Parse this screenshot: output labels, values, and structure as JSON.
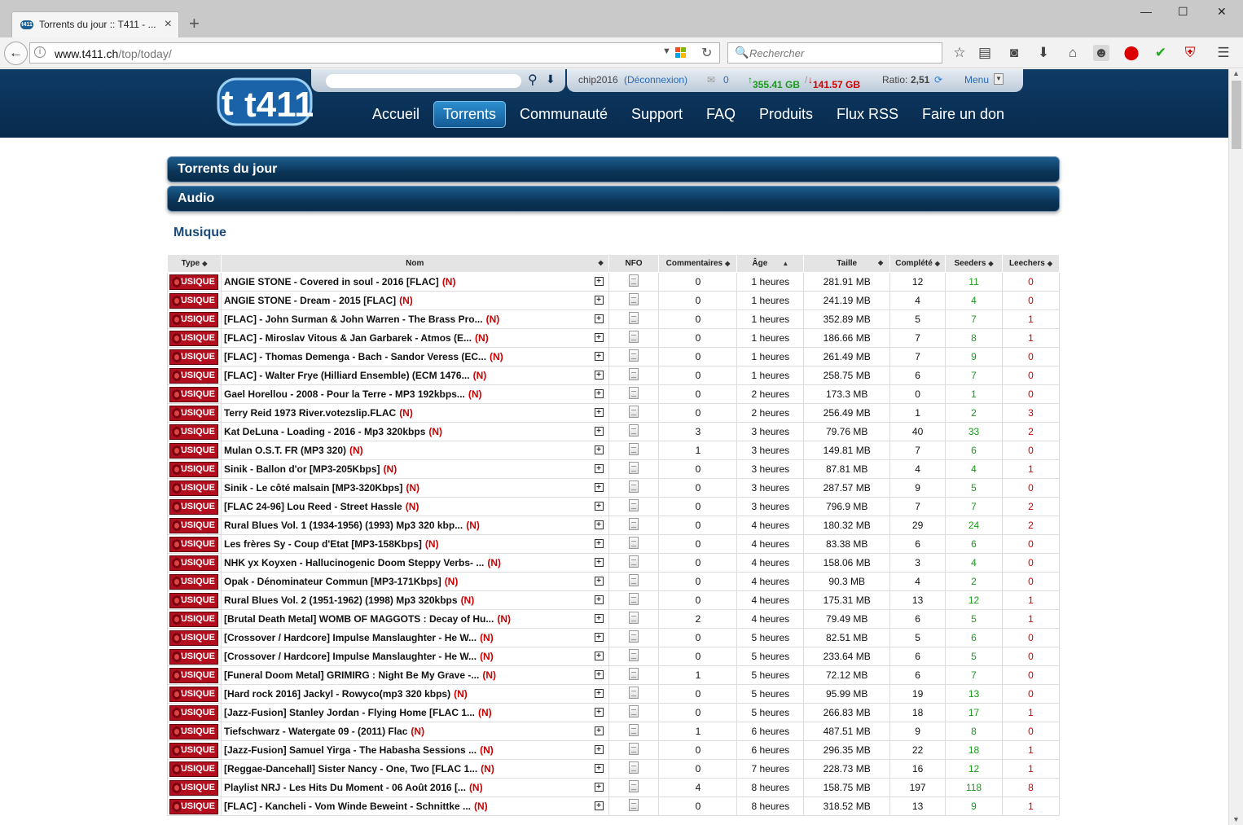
{
  "browser": {
    "tab_title": "Torrents du jour :: T411 - ...",
    "tab_close": "×",
    "new_tab": "+",
    "url_domain": "www.t411.ch",
    "url_path": "/top/today/",
    "search_placeholder": "Rechercher",
    "window_controls": [
      "—",
      "☐",
      "✕"
    ]
  },
  "site": {
    "logo_text": "t411",
    "user": {
      "username": "chip2016",
      "logout": "(Déconnexion)",
      "messages": "0",
      "upload": "355.41 GB",
      "download": "141.57 GB",
      "ratio_label": "Ratio:",
      "ratio": "2,51",
      "menu": "Menu"
    },
    "nav": [
      "Accueil",
      "Torrents",
      "Communauté",
      "Support",
      "FAQ",
      "Produits",
      "Flux RSS",
      "Faire un don"
    ],
    "active_nav": "Torrents"
  },
  "content": {
    "bar_title": "Torrents du jour",
    "category_bar": "Audio",
    "section_title": "Musique",
    "columns": [
      "Type",
      "Nom",
      "NFO",
      "Commentaires",
      "Âge",
      "Taille",
      "Complété",
      "Seeders",
      "Leechers"
    ],
    "badge_label": "MUSIQUE",
    "new_marker": "(N)",
    "rows": [
      {
        "name": "ANGIE STONE - Covered in soul - 2016 [FLAC]",
        "comments": "0",
        "age": "1 heures",
        "size": "281.91 MB",
        "completed": "12",
        "seeders": "11",
        "leechers": "0"
      },
      {
        "name": "ANGIE STONE - Dream - 2015 [FLAC]",
        "comments": "0",
        "age": "1 heures",
        "size": "241.19 MB",
        "completed": "4",
        "seeders": "4",
        "leechers": "0"
      },
      {
        "name": "[FLAC] - John Surman & John Warren - The Brass Pro...",
        "comments": "0",
        "age": "1 heures",
        "size": "352.89 MB",
        "completed": "5",
        "seeders": "7",
        "leechers": "1"
      },
      {
        "name": "[FLAC] - Miroslav Vitous & Jan Garbarek - Atmos (E...",
        "comments": "0",
        "age": "1 heures",
        "size": "186.66 MB",
        "completed": "7",
        "seeders": "8",
        "leechers": "1"
      },
      {
        "name": "[FLAC] - Thomas Demenga - Bach - Sandor Veress (EC...",
        "comments": "0",
        "age": "1 heures",
        "size": "261.49 MB",
        "completed": "7",
        "seeders": "9",
        "leechers": "0"
      },
      {
        "name": "[FLAC] - Walter Frye (Hilliard Ensemble) (ECM 1476...",
        "comments": "0",
        "age": "1 heures",
        "size": "258.75 MB",
        "completed": "6",
        "seeders": "7",
        "leechers": "0"
      },
      {
        "name": "Gael Horellou - 2008 - Pour la Terre - MP3 192kbps...",
        "comments": "0",
        "age": "2 heures",
        "size": "173.3 MB",
        "completed": "0",
        "seeders": "1",
        "leechers": "0"
      },
      {
        "name": "Terry Reid 1973 River.votezslip.FLAC",
        "comments": "0",
        "age": "2 heures",
        "size": "256.49 MB",
        "completed": "1",
        "seeders": "2",
        "leechers": "3"
      },
      {
        "name": "Kat DeLuna - Loading - 2016 - Mp3 320kbps",
        "comments": "3",
        "age": "3 heures",
        "size": "79.76 MB",
        "completed": "40",
        "seeders": "33",
        "leechers": "2"
      },
      {
        "name": "Mulan O.S.T. FR (MP3 320)",
        "comments": "1",
        "age": "3 heures",
        "size": "149.81 MB",
        "completed": "7",
        "seeders": "6",
        "leechers": "0"
      },
      {
        "name": "Sinik - Ballon d'or [MP3-205Kbps]",
        "comments": "0",
        "age": "3 heures",
        "size": "87.81 MB",
        "completed": "4",
        "seeders": "4",
        "leechers": "1"
      },
      {
        "name": "Sinik - Le côté malsain [MP3-320Kbps]",
        "comments": "0",
        "age": "3 heures",
        "size": "287.57 MB",
        "completed": "9",
        "seeders": "5",
        "leechers": "0"
      },
      {
        "name": "[FLAC 24-96] Lou Reed - Street Hassle",
        "comments": "0",
        "age": "3 heures",
        "size": "796.9 MB",
        "completed": "7",
        "seeders": "7",
        "leechers": "2"
      },
      {
        "name": "Rural Blues Vol. 1 (1934-1956) (1993) Mp3 320 kbp...",
        "comments": "0",
        "age": "4 heures",
        "size": "180.32 MB",
        "completed": "29",
        "seeders": "24",
        "leechers": "2"
      },
      {
        "name": "Les frères Sy - Coup d'Etat [MP3-158Kbps]",
        "comments": "0",
        "age": "4 heures",
        "size": "83.38 MB",
        "completed": "6",
        "seeders": "6",
        "leechers": "0"
      },
      {
        "name": "NHK yx Koyxen - Hallucinogenic Doom Steppy Verbs- ...",
        "comments": "0",
        "age": "4 heures",
        "size": "158.06 MB",
        "completed": "3",
        "seeders": "4",
        "leechers": "0"
      },
      {
        "name": "Opak - Dénominateur Commun [MP3-171Kbps]",
        "comments": "0",
        "age": "4 heures",
        "size": "90.3 MB",
        "completed": "4",
        "seeders": "2",
        "leechers": "0"
      },
      {
        "name": "Rural Blues Vol. 2 (1951-1962) (1998) Mp3 320kbps",
        "comments": "0",
        "age": "4 heures",
        "size": "175.31 MB",
        "completed": "13",
        "seeders": "12",
        "leechers": "1"
      },
      {
        "name": "[Brutal Death Metal] WOMB OF MAGGOTS : Decay of Hu...",
        "comments": "2",
        "age": "4 heures",
        "size": "79.49 MB",
        "completed": "6",
        "seeders": "5",
        "leechers": "1"
      },
      {
        "name": "[Crossover / Hardcore] Impulse Manslaughter - He W...",
        "comments": "0",
        "age": "5 heures",
        "size": "82.51 MB",
        "completed": "5",
        "seeders": "6",
        "leechers": "0"
      },
      {
        "name": "[Crossover / Hardcore] Impulse Manslaughter - He W...",
        "comments": "0",
        "age": "5 heures",
        "size": "233.64 MB",
        "completed": "6",
        "seeders": "5",
        "leechers": "0"
      },
      {
        "name": "[Funeral Doom Metal] GRIMIRG : Night Be My Grave -...",
        "comments": "1",
        "age": "5 heures",
        "size": "72.12 MB",
        "completed": "6",
        "seeders": "7",
        "leechers": "0"
      },
      {
        "name": "[Hard rock 2016] Jackyl - Rowyco(mp3 320 kbps)",
        "comments": "0",
        "age": "5 heures",
        "size": "95.99 MB",
        "completed": "19",
        "seeders": "13",
        "leechers": "0"
      },
      {
        "name": "[Jazz-Fusion] Stanley Jordan - Flying Home [FLAC 1...",
        "comments": "0",
        "age": "5 heures",
        "size": "266.83 MB",
        "completed": "18",
        "seeders": "17",
        "leechers": "1"
      },
      {
        "name": "Tiefschwarz - Watergate 09 - (2011) Flac",
        "comments": "1",
        "age": "6 heures",
        "size": "487.51 MB",
        "completed": "9",
        "seeders": "8",
        "leechers": "0"
      },
      {
        "name": "[Jazz-Fusion] Samuel Yirga - The Habasha Sessions ...",
        "comments": "0",
        "age": "6 heures",
        "size": "296.35 MB",
        "completed": "22",
        "seeders": "18",
        "leechers": "1"
      },
      {
        "name": "[Reggae-Dancehall] Sister Nancy - One, Two [FLAC 1...",
        "comments": "0",
        "age": "7 heures",
        "size": "228.73 MB",
        "completed": "16",
        "seeders": "12",
        "leechers": "1"
      },
      {
        "name": "Playlist NRJ - Les Hits Du Moment - 06 Août 2016 [...",
        "comments": "4",
        "age": "8 heures",
        "size": "158.75 MB",
        "completed": "197",
        "seeders": "118",
        "leechers": "8"
      },
      {
        "name": "[FLAC] - Kancheli - Vom Winde Beweint - Schnittke ...",
        "comments": "0",
        "age": "8 heures",
        "size": "318.52 MB",
        "completed": "13",
        "seeders": "9",
        "leechers": "1"
      }
    ]
  },
  "colors": {
    "header_bg": "#0b3558",
    "badge_red": "#b30e1e",
    "seeders_green": "#1a9a1a",
    "leechers_red": "#d10000",
    "new_red": "#cc0000"
  }
}
